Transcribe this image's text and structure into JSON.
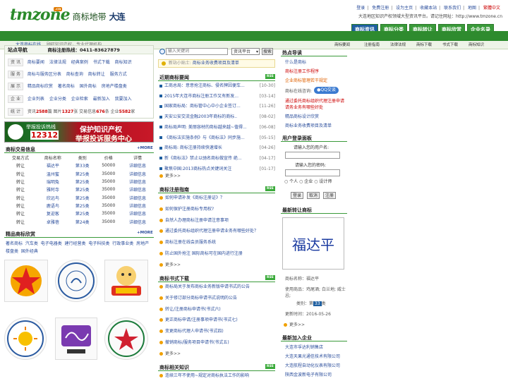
{
  "header": {
    "logo_text": "tmzone",
    "logo_badge": ".cn",
    "site_name": "商标地带",
    "city": "大连",
    "top_links": [
      "登录",
      "免费注册",
      "设为主页",
      "收藏本站",
      "联系我们",
      "地图"
    ],
    "top_link_hl": "繁體中文",
    "tagline": "大连地区知识产权领域大型资讯平台。请记住网址：http://www.tmzone.cn"
  },
  "nav": {
    "tabs": [
      {
        "label": "商标资讯",
        "active": true
      },
      {
        "label": "商标分类",
        "active": false
      },
      {
        "label": "商标转让",
        "active": false
      },
      {
        "label": "商标欣赏",
        "active": false
      },
      {
        "label": "企业名录",
        "active": false
      }
    ],
    "subnav_left": "大连商标在线",
    "subnav_slogan": "顾旺知识产权，专业代理机构",
    "subnav_right": [
      "商标要闻",
      "注册指南",
      "法律法规",
      "商标下载",
      "书式下载",
      "商标知识"
    ]
  },
  "station": {
    "title": "站点导航",
    "phone_label": "商标注册热线：",
    "phone": "0411-83627879",
    "rows": [
      {
        "label": "资 讯",
        "links": [
          "商标要闻",
          "法律法规",
          "经典案例",
          "书式下载",
          "商标知识"
        ]
      },
      {
        "label": "服 务",
        "links": [
          "商标与服务区分表",
          "商标查询",
          "商标转让",
          "服务方式"
        ]
      },
      {
        "label": "展 示",
        "links": [
          "精品商标欣赏",
          "著名商标",
          "国外商标",
          "房地产楼盘类"
        ]
      },
      {
        "label": "企 业",
        "links": [
          "企业列表",
          "企业分类",
          "企业检索",
          "最新加入",
          "我要加入"
        ]
      }
    ],
    "stats_label": "统 计",
    "stats": "资讯2588篇 图片1327张 交易信息676条 企业5582家"
  },
  "banner": {
    "hotline_label": "举报投诉热线",
    "hotline_number": "12312",
    "slogan1": "保护知识产权",
    "slogan2": "举报投诉服务中心"
  },
  "trade": {
    "title": "商标交易信息",
    "more": "+MORE",
    "headers": [
      "交易方式",
      "商标名称",
      "类别",
      "价格",
      "详情"
    ],
    "rows": [
      [
        "转让",
        "福达平",
        "第33类",
        "50000",
        "详细信息"
      ],
      [
        "转让",
        "温州蜜",
        "第25类",
        "35000",
        "详细信息"
      ],
      [
        "转让",
        "瑞明兔",
        "第25类",
        "35000",
        "详细信息"
      ],
      [
        "转让",
        "雅阿寺",
        "第25类",
        "35000",
        "详细信息"
      ],
      [
        "转让",
        "欣远鸟",
        "第25类",
        "35000",
        "详细信息"
      ],
      [
        "转让",
        "鹿语鸟",
        "第25类",
        "35000",
        "详细信息"
      ],
      [
        "转让",
        "复迎客",
        "第25类",
        "35000",
        "详细信息"
      ],
      [
        "转让",
        "卓雅蓓",
        "第24类",
        "35000",
        "详细信息"
      ]
    ]
  },
  "fine": {
    "title": "精品商标欣赏",
    "more": "+MORE",
    "links": [
      "著名商标",
      "汽车类",
      "电子电器类",
      "建行经营类",
      "电子科技类",
      "行政事业类",
      "房地产楼盘类",
      "国外经典"
    ]
  },
  "search": {
    "placeholder": "输入关键词",
    "select": "资讯平台",
    "button": "搜索",
    "tip_label": "新站小贴士:",
    "tip": "商标业务收费项目及清单"
  },
  "news": {
    "title": "近期商标要闻",
    "rss": "RSS",
    "items": [
      {
        "t": "工商总局：意意抢注商标、侵名牌因便车...",
        "d": "[10-30]"
      },
      {
        "t": "2015年大连市商标注册工作又有新发...",
        "d": "[03-14]"
      },
      {
        "t": "国家商标局：商标管中心中小企业签订...",
        "d": "[11-26]"
      },
      {
        "t": "天安公安交流金融2003年商标的商标..",
        "d": "[08-02]"
      },
      {
        "t": "商标局声明: 美丽容材的商标越来越~值得...",
        "d": "[06-08]"
      },
      {
        "t": "《商标法实施条例》与《商标法》同步施...",
        "d": "[05-15]"
      },
      {
        "t": "商标局: 商标注册持续快速增长",
        "d": "[04-26]"
      },
      {
        "t": "新《商标法》禁止以驰名商标做宣传 绝...",
        "d": "[04-17]"
      },
      {
        "t": "聚焦中国:2013商标热点关键词关注",
        "d": "[01-17]"
      }
    ],
    "more": "更多>>"
  },
  "guide": {
    "title": "商标注册指南",
    "rss": "RSS",
    "items": [
      "如何申请补发《商标注册证》？",
      "如何保护注册商标专用权?",
      "自然人办理商标注册申请注意事项",
      "通过委托商标组织代理注册申请业务有哪些好处？",
      "商标注册在线会员服务系统",
      "防止国外抢注 国际商标可在国内进行注册"
    ],
    "more": "更多>>"
  },
  "download": {
    "title": "商标书式下载",
    "rss": "RSS",
    "items": [
      "商标局关于发布商标业务新版申请书式的公告",
      "关于修订部分商标申请书式说明的公告",
      "转让/注册商标申请书(书式六)",
      "更正商标申请/注册事项申请书(书式七)",
      "变更商标代理人申请书(书式四)",
      "撤销商标/服务项目申请书(书式五)"
    ],
    "more": "更多>>"
  },
  "knowledge": {
    "title": "商标相关知识",
    "rss": "RSS",
    "items": [
      "连续三年不使用~规定对商标执法工作的影响"
    ]
  },
  "hot": {
    "title": "热点导读",
    "links": [
      "什么是商标",
      "商标注册工作程序",
      "企业商标管理若干规定"
    ],
    "consult_label": "商标在线咨询:",
    "consult_btn": "QQ交谈",
    "links2": [
      "通过委托商标组织代理注册申请",
      "请务业务有哪些好处",
      "精品商标设计欣赏",
      "商标业务收费项目及清单"
    ]
  },
  "login": {
    "title": "用户登录面板",
    "user_label": "请输入您的用户名:",
    "pass_label": "请输入您的密码:",
    "roles": [
      "个人",
      "企业",
      "设计师"
    ],
    "buttons": [
      "登录",
      "取消",
      "注册"
    ]
  },
  "latest": {
    "title": "最新转让商标",
    "image_text": "福达平",
    "name_label": "商标名称：",
    "name": "福达平",
    "use_label": "使用商品：",
    "use": "鸡尾酒; 白兰地; 威士忌;",
    "class_label": "类别：",
    "class_pre": "第",
    "class_num": "33",
    "class_post": "类",
    "time_label": "更新时间：",
    "time": "2016-05-26",
    "more": "更多>>"
  },
  "newcomp": {
    "title": "最新加入企业",
    "items": [
      "大连市孚达利销售店",
      "大连天果光通信技术有限公司",
      "大连航程自动化仪表有限公司",
      "陕西金波新电子有限公司"
    ]
  },
  "colors": {
    "green": "#2e8b2e",
    "blue": "#1f5fa0",
    "red": "#c00000"
  }
}
